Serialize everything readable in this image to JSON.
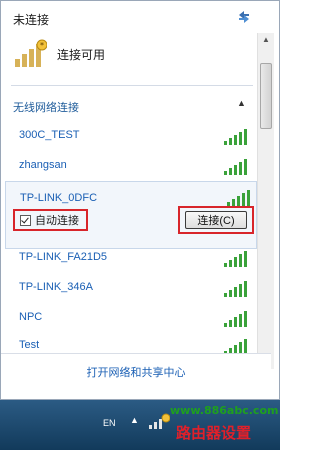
{
  "header": {
    "title": "未连接",
    "refresh_icon": "refresh-icon"
  },
  "status": {
    "label": "连接可用",
    "icon": "network-unavailable-icon"
  },
  "section": {
    "label": "无线网络连接",
    "collapse_icon": "chevron-up-icon"
  },
  "networks": [
    {
      "name": "300C_TEST"
    },
    {
      "name": "zhangsan"
    }
  ],
  "expanded_network": {
    "name": "TP-LINK_0DFC",
    "auto_connect_label": "自动连接",
    "auto_connect_checked": true,
    "connect_button": "连接(C)"
  },
  "networks_more": [
    {
      "name": "TP-LINK_FA21D5"
    },
    {
      "name": "TP-LINK_346A"
    },
    {
      "name": "NPC"
    },
    {
      "name": "Test"
    }
  ],
  "footer": {
    "link": "打开网络和共享中心"
  },
  "taskbar": {
    "lang": "EN",
    "tray_arrow": "▲"
  },
  "watermark": {
    "url": "www.886abc.com",
    "name": "路由器设置"
  },
  "colors": {
    "accent_red": "#d8252a",
    "link_blue": "#1a5fb4",
    "signal_green": "#3aa23a"
  }
}
